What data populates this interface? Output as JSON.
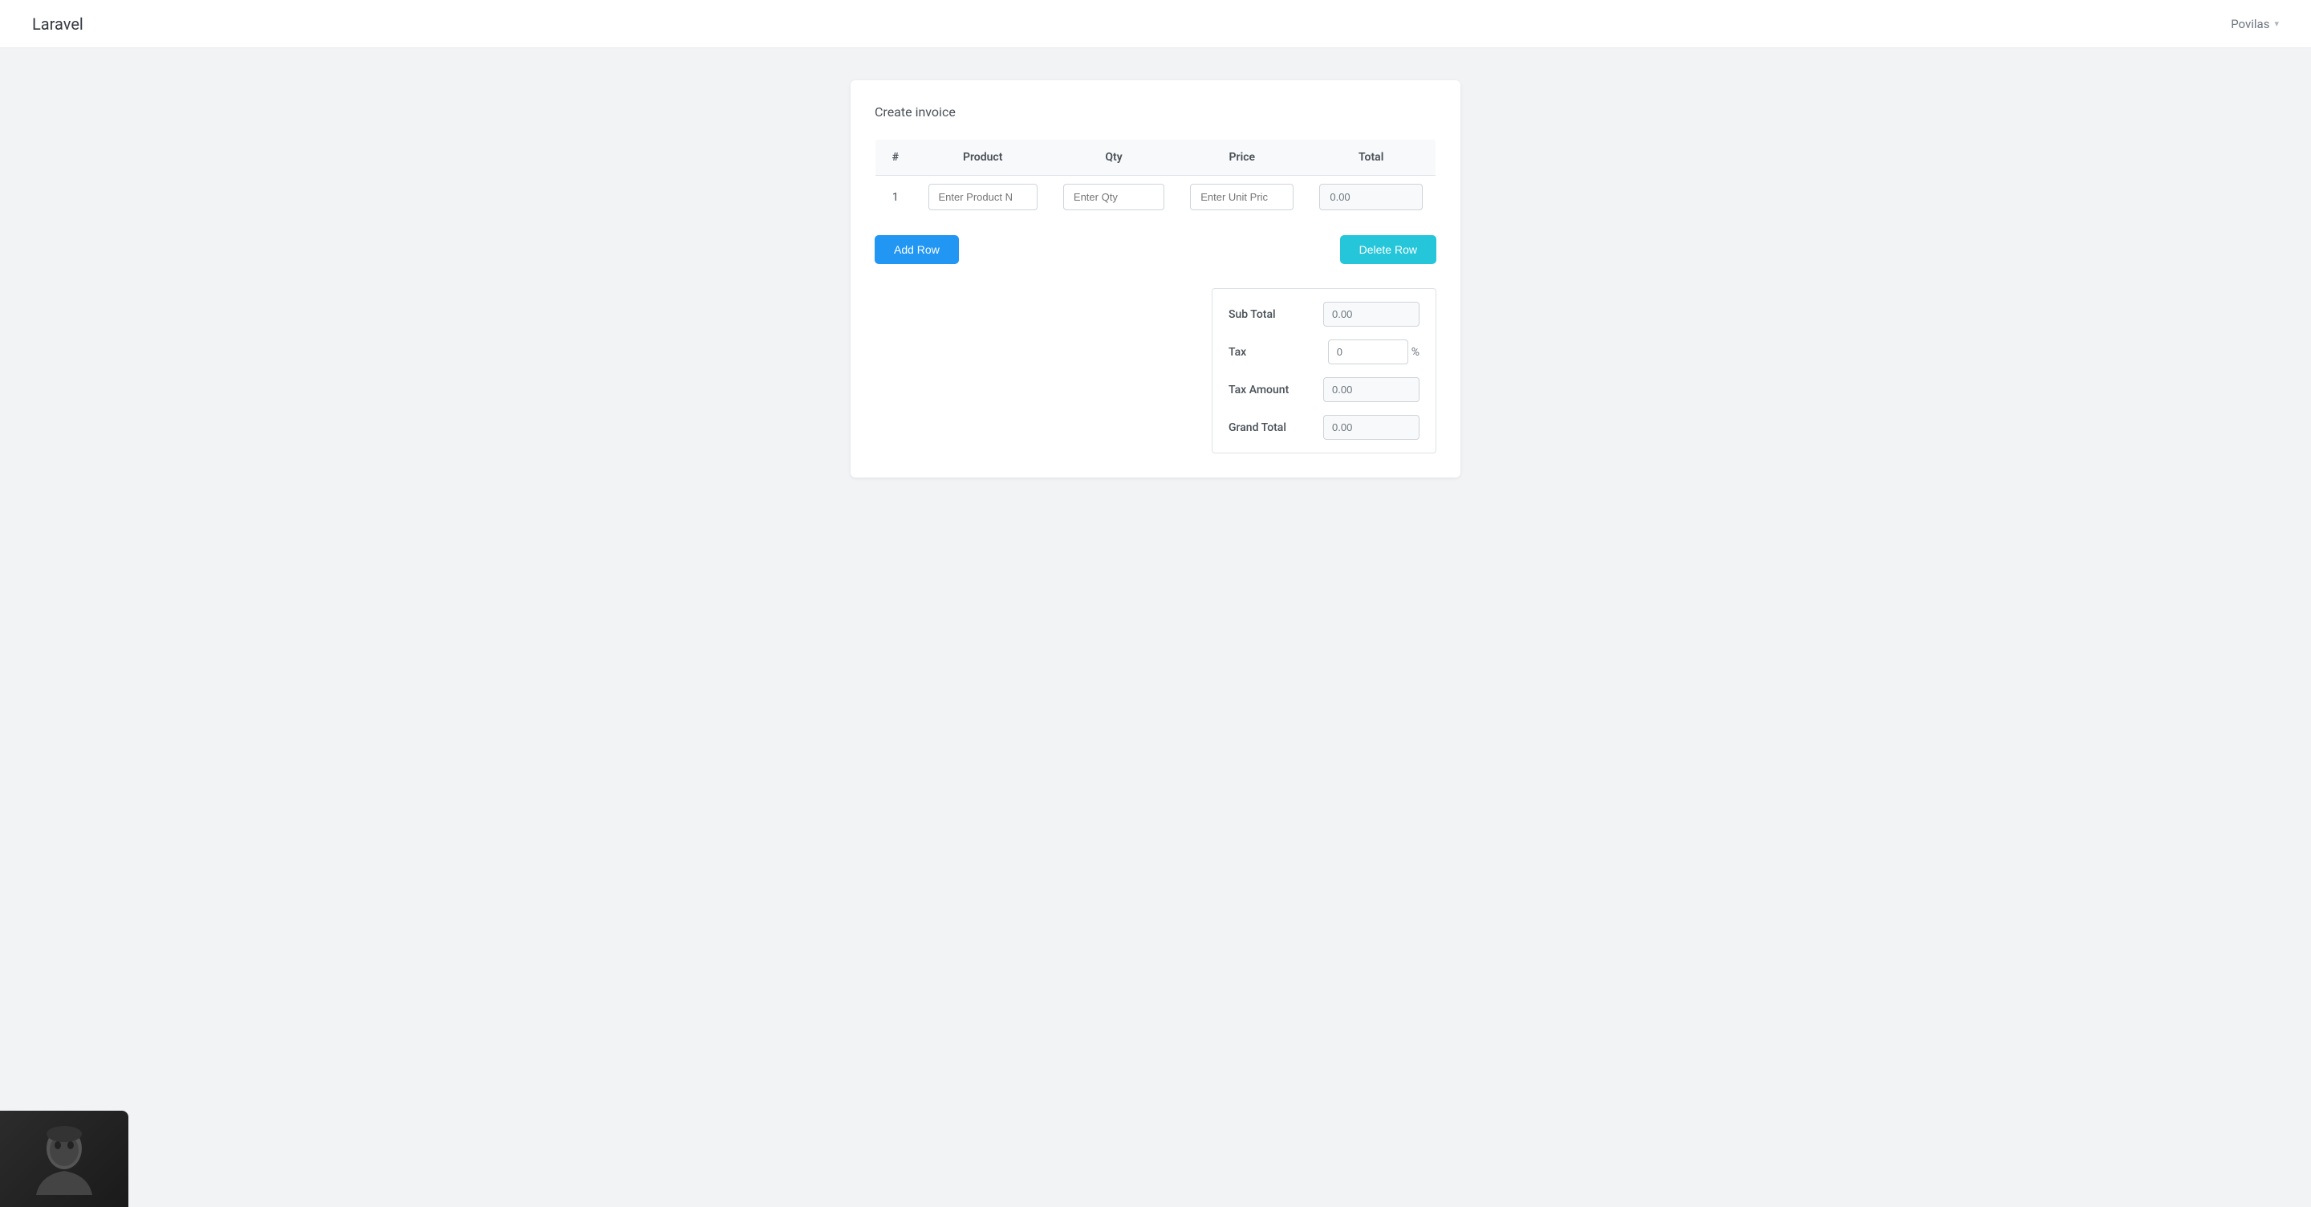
{
  "navbar": {
    "brand": "Laravel",
    "user": "Povilas",
    "chevron": "▾"
  },
  "page": {
    "title": "Create invoice"
  },
  "table": {
    "headers": [
      "#",
      "Product",
      "Qty",
      "Price",
      "Total"
    ],
    "rows": [
      {
        "number": "1",
        "product_placeholder": "Enter Product N",
        "qty_placeholder": "Enter Qty",
        "price_placeholder": "Enter Unit Pric",
        "total_value": "0.00"
      }
    ]
  },
  "buttons": {
    "add_row": "Add Row",
    "delete_row": "Delete Row"
  },
  "totals": {
    "sub_total_label": "Sub Total",
    "sub_total_value": "0.00",
    "tax_label": "Tax",
    "tax_value": "0",
    "tax_percent_symbol": "%",
    "tax_amount_label": "Tax Amount",
    "tax_amount_value": "0.00",
    "grand_total_label": "Grand Total",
    "grand_total_value": "0.00"
  }
}
